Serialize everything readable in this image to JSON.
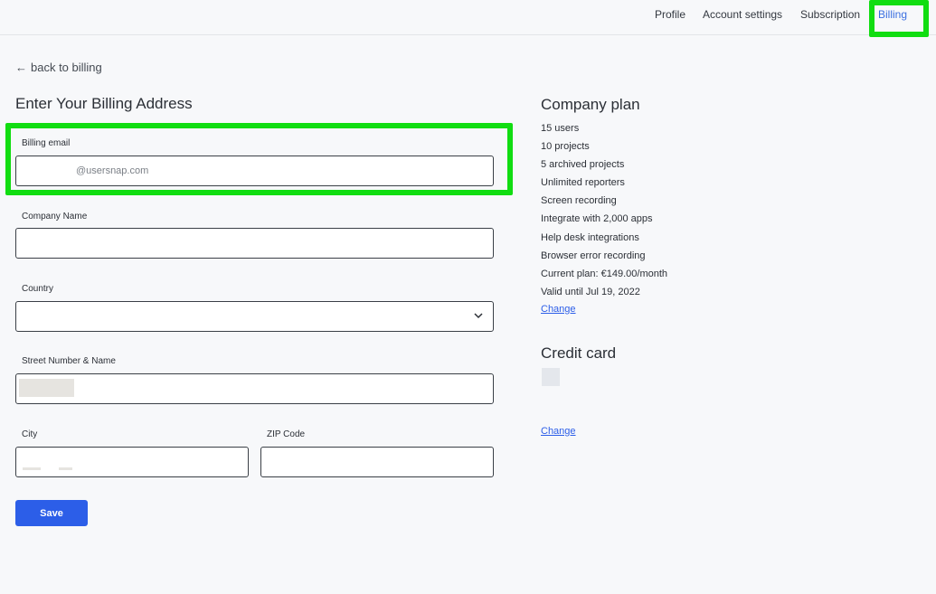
{
  "nav": {
    "items": [
      {
        "label": "Profile"
      },
      {
        "label": "Account settings"
      },
      {
        "label": "Subscription"
      },
      {
        "label": "Billing"
      }
    ],
    "active": "Billing"
  },
  "back_link": {
    "arrow": "←",
    "label": "back to billing"
  },
  "form": {
    "title": "Enter Your Billing Address",
    "billing_email": {
      "label": "Billing email",
      "value": "@usersnap.com"
    },
    "company_name": {
      "label": "Company Name",
      "value": ""
    },
    "country": {
      "label": "Country",
      "value": ""
    },
    "street": {
      "label": "Street Number & Name",
      "value": ""
    },
    "city": {
      "label": "City",
      "value": ""
    },
    "zip": {
      "label": "ZIP Code",
      "value": ""
    },
    "save_label": "Save"
  },
  "plan": {
    "title": "Company plan",
    "features": [
      "15 users",
      "10 projects",
      "5 archived projects",
      "Unlimited reporters",
      "Screen recording",
      "Integrate with 2,000 apps",
      "Help desk integrations",
      "Browser error recording",
      "Current plan: €149.00/month",
      "Valid until Jul 19, 2022"
    ],
    "change_label": "Change"
  },
  "credit_card": {
    "title": "Credit card",
    "change_label": "Change"
  },
  "colors": {
    "accent": "#2c5ee8",
    "highlight": "#11dd11",
    "background": "#f7f8fa"
  }
}
